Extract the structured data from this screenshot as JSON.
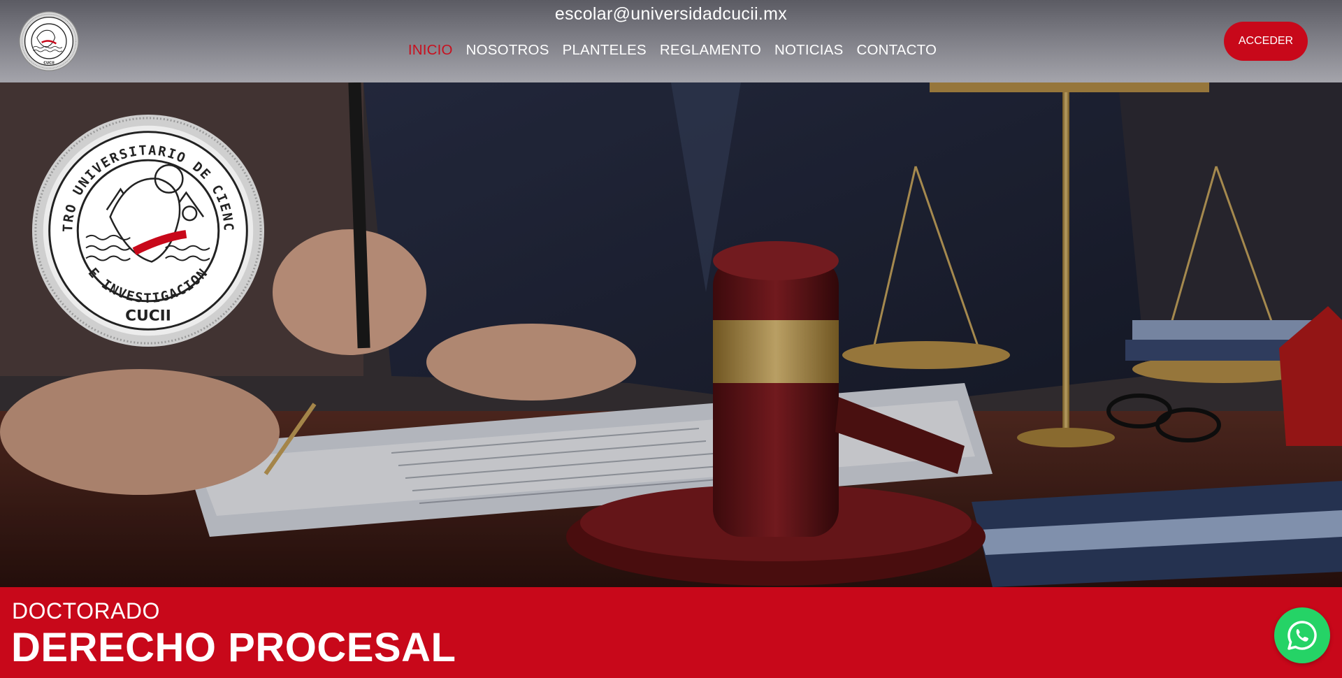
{
  "header": {
    "email": "escolar@universidadcucii.mx",
    "logo_icon": "university-seal-icon",
    "nav": [
      {
        "label": "INICIO",
        "active": true
      },
      {
        "label": "NOSOTROS",
        "active": false
      },
      {
        "label": "PLANTELES",
        "active": false
      },
      {
        "label": "REGLAMENTO",
        "active": false
      },
      {
        "label": "NOTICIAS",
        "active": false
      },
      {
        "label": "CONTACTO",
        "active": false
      }
    ],
    "login_label": "ACCEDER"
  },
  "hero": {
    "image": "lawyer-signing-document-with-gavel-and-scales-photo",
    "seal": {
      "ring_text_top": "CENTRO UNIVERSITARIO DE CIENCIAS",
      "ring_text_bottom": "E INVESTIGACION",
      "name": "CUCII",
      "icon": "deer-head-seal-icon"
    }
  },
  "program": {
    "level": "DOCTORADO",
    "title": "DERECHO PROCESAL"
  },
  "floating": {
    "whatsapp_icon": "whatsapp-icon"
  },
  "colors": {
    "accent_red": "#c8081a",
    "nav_active": "#c8101e",
    "whatsapp_green": "#25d366"
  }
}
